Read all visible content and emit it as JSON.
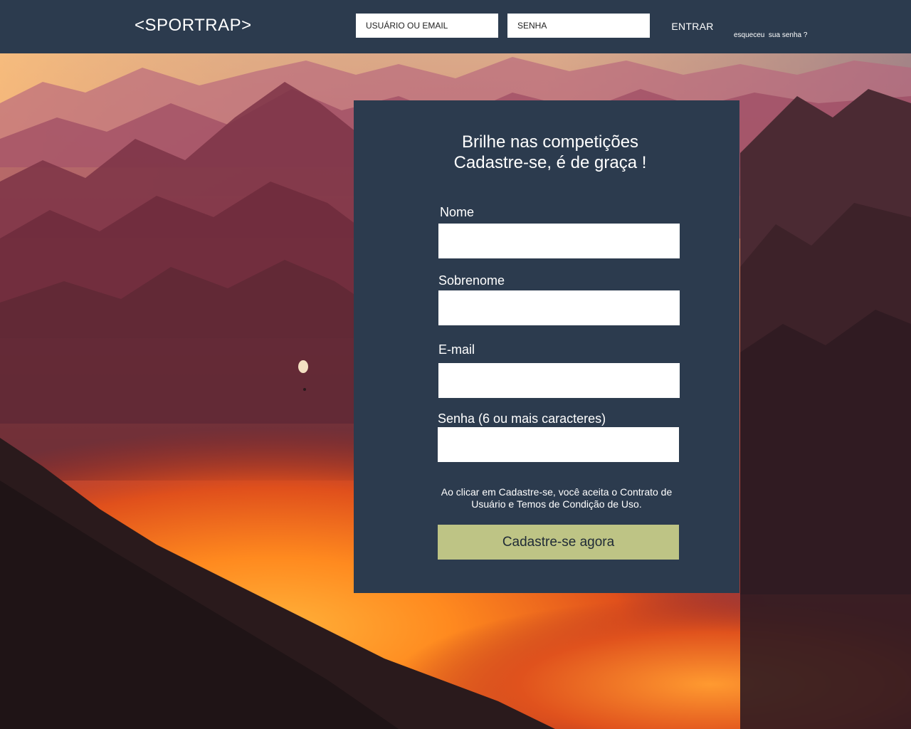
{
  "header": {
    "logo": "<SPORTRAP>",
    "username_placeholder": "USUÁRIO OU EMAIL",
    "password_placeholder": "SENHA",
    "login_label": "ENTRAR",
    "forgot_label": "esqueceu  sua senha ?"
  },
  "signup": {
    "title_line1": "Brilhe nas competições",
    "title_line2": "Cadastre-se, é de graça !",
    "fields": [
      {
        "label": "Nome",
        "value": ""
      },
      {
        "label": "Sobrenome",
        "value": ""
      },
      {
        "label": "E-mail",
        "value": ""
      },
      {
        "label": "Senha (6 ou mais caracteres)",
        "value": ""
      }
    ],
    "terms_line1": "Ao clicar em Cadastre-se, você aceita o Contrato de",
    "terms_line2": "Usuário e Temos de Condição de Uso.",
    "submit_label": "Cadastre-se agora"
  },
  "colors": {
    "navy": "#2c3b4e",
    "button": "#bec485",
    "white": "#ffffff"
  }
}
